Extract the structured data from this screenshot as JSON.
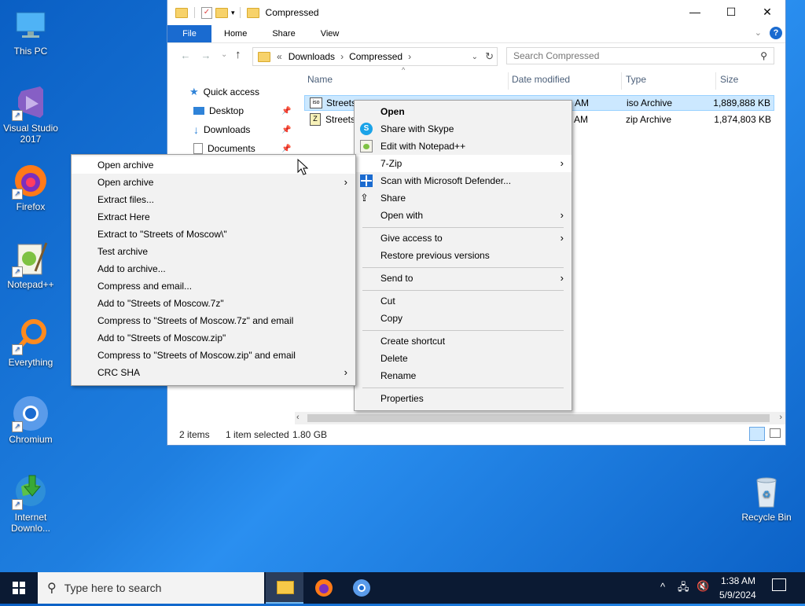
{
  "desktop": {
    "icons": [
      {
        "label": "This PC"
      },
      {
        "label": "Visual Studio 2017"
      },
      {
        "label": "Firefox"
      },
      {
        "label": "Notepad++"
      },
      {
        "label": "Everything"
      },
      {
        "label": "Chromium"
      },
      {
        "label": "Internet Downlo..."
      },
      {
        "label": "Recycle Bin"
      }
    ]
  },
  "explorer": {
    "title": "Compressed",
    "ribbon": {
      "file": "File",
      "home": "Home",
      "share": "Share",
      "view": "View"
    },
    "address": {
      "overflow": "«",
      "segments": [
        "Downloads",
        "Compressed"
      ]
    },
    "search_placeholder": "Search Compressed",
    "columns": {
      "name": "Name",
      "date": "Date modified",
      "type": "Type",
      "size": "Size"
    },
    "nav": {
      "quick_access": "Quick access",
      "items": [
        {
          "label": "Desktop"
        },
        {
          "label": "Downloads"
        },
        {
          "label": "Documents"
        }
      ]
    },
    "files": [
      {
        "name": "Streets",
        "date": "AM",
        "type": "iso Archive",
        "size": "1,889,888 KB"
      },
      {
        "name": "Streets-",
        "date": "AM",
        "type": "zip Archive",
        "size": "1,874,803 KB"
      }
    ],
    "status": {
      "items": "2 items",
      "selected": "1 item selected",
      "size": "1.80 GB"
    }
  },
  "context_menu": {
    "open": "Open",
    "skype": "Share with Skype",
    "notepad": "Edit with Notepad++",
    "sevenzip": "7-Zip",
    "defender": "Scan with Microsoft Defender...",
    "share": "Share",
    "open_with": "Open with",
    "give_access": "Give access to",
    "restore": "Restore previous versions",
    "send_to": "Send to",
    "cut": "Cut",
    "copy": "Copy",
    "create_shortcut": "Create shortcut",
    "delete": "Delete",
    "rename": "Rename",
    "properties": "Properties"
  },
  "sevenzip_menu": {
    "items": [
      "Open archive",
      "Open archive",
      "Extract files...",
      "Extract Here",
      "Extract to \"Streets of Moscow\\\"",
      "Test archive",
      "Add to archive...",
      "Compress and email...",
      "Add to \"Streets of Moscow.7z\"",
      "Compress to \"Streets of Moscow.7z\" and email",
      "Add to \"Streets of Moscow.zip\"",
      "Compress to \"Streets of Moscow.zip\" and email",
      "CRC SHA"
    ]
  },
  "taskbar": {
    "search_placeholder": "Type here to search",
    "time": "1:38 AM",
    "date": "5/9/2024"
  },
  "colors": {
    "accent": "#1a6bd0",
    "selection": "#cce8ff",
    "taskbar": "#0b1a33"
  }
}
